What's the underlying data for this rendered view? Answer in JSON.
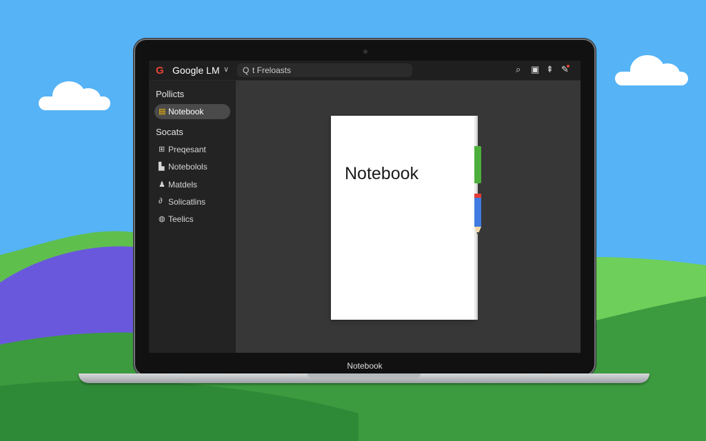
{
  "app": {
    "logo_letter": "G",
    "name": "Google LM",
    "search_text": "t Freloasts"
  },
  "sidebar": {
    "section1_title": "Pollicts",
    "active_item": "Notebook",
    "section2_title": "Socats",
    "items": [
      {
        "label": "Preqesant",
        "icon": "grid-icon"
      },
      {
        "label": "Notebolols",
        "icon": "briefcase-icon"
      },
      {
        "label": "Matdels",
        "icon": "person-icon"
      },
      {
        "label": "Solicatlins",
        "icon": "link-icon"
      },
      {
        "label": "Teelics",
        "icon": "settings-icon"
      }
    ]
  },
  "main": {
    "notebook_title": "Notebook"
  },
  "laptop": {
    "bezel_label": "Notebook"
  },
  "colors": {
    "sky": "#55b3f6",
    "hill_purple": "#6a58dc",
    "hill_green_light": "#6fcf5b",
    "hill_green_dark": "#3c9a3f",
    "accent_green": "#4caf3c",
    "pencil_blue": "#3f7be0"
  }
}
